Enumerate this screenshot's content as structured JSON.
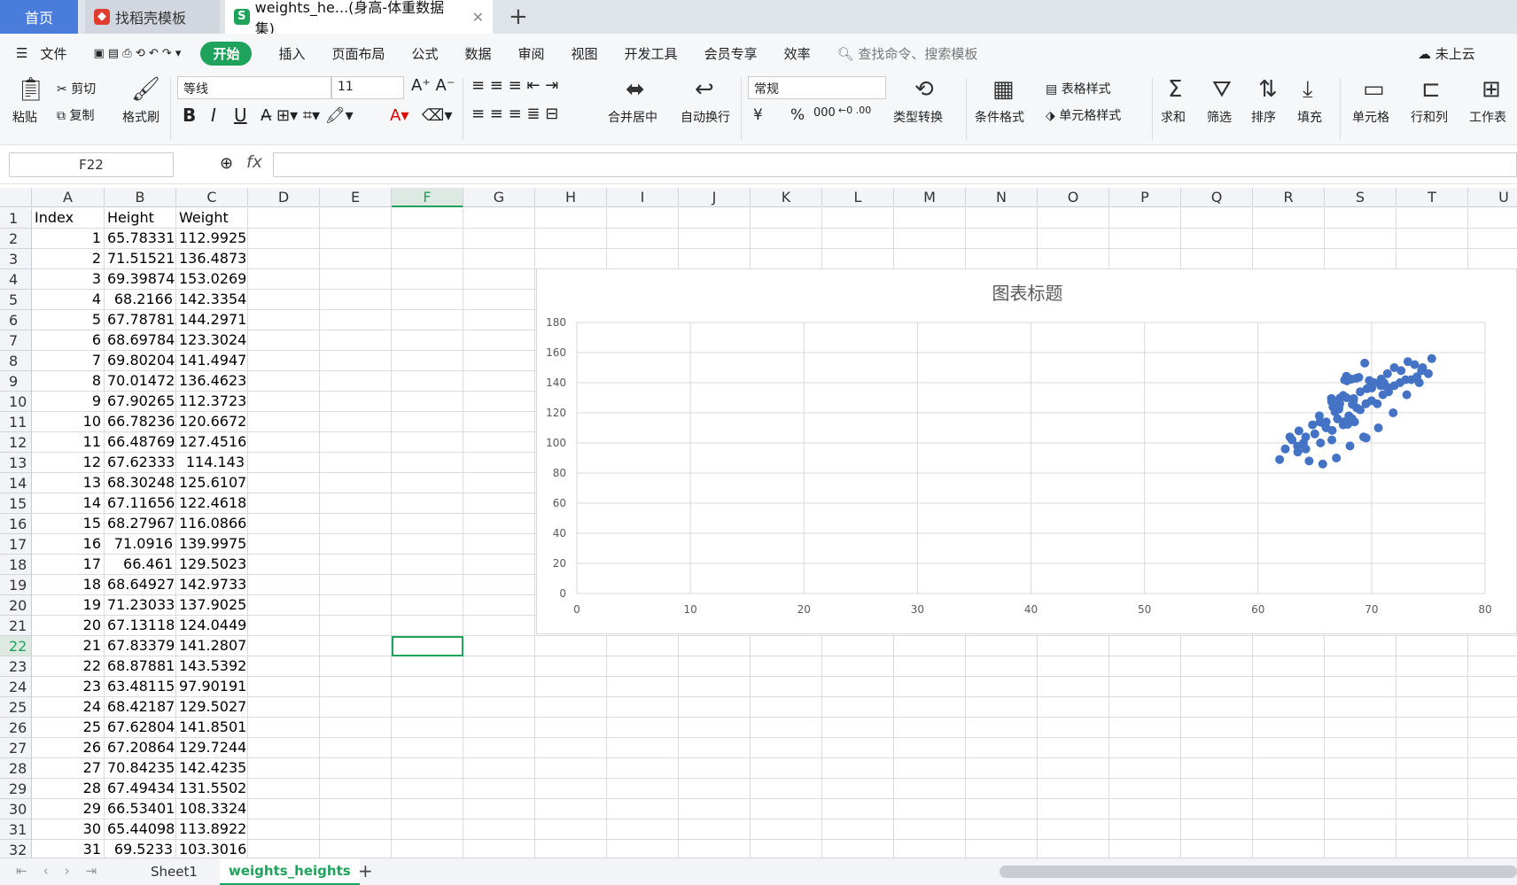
{
  "tabs": {
    "home": "首页",
    "daoke": "找稻壳模板",
    "file": "weights_he...(身高-体重数据集)",
    "file_icon": "S",
    "new_tab": "+"
  },
  "menu": {
    "file": "文件",
    "items": [
      "开始",
      "插入",
      "页面布局",
      "公式",
      "数据",
      "审阅",
      "视图",
      "开发工具",
      "会员专享",
      "效率"
    ],
    "search": "查找命令、搜索模板",
    "cloud": "未上云"
  },
  "toolbar": {
    "paste": "粘贴",
    "cut": "剪切",
    "copy": "复制",
    "format_painter": "格式刷",
    "font_name": "等线",
    "font_size": "11",
    "merge_center": "合并居中",
    "wrap_text": "自动换行",
    "number_format": "常规",
    "convert": "类型转换",
    "cond_format": "条件格式",
    "table_style": "表格样式",
    "cell_style": "单元格样式",
    "sum": "求和",
    "filter": "筛选",
    "sort": "排序",
    "fill": "填充",
    "cell": "单元格",
    "row_col": "行和列",
    "worksheet": "工作表",
    "bold": "B",
    "italic": "I",
    "underline": "U",
    "currency": "¥",
    "percent": "%",
    "thousands": "000"
  },
  "formula_bar": {
    "cell_ref": "F22",
    "fx": "fx",
    "value": ""
  },
  "columns": [
    "A",
    "B",
    "C",
    "D",
    "E",
    "F",
    "G",
    "H",
    "I",
    "J",
    "K",
    "L",
    "M",
    "N",
    "O",
    "P",
    "Q",
    "R",
    "S",
    "T",
    "U"
  ],
  "headers": [
    "Index",
    "Height",
    "Weight"
  ],
  "rows": [
    [
      "1",
      "65.78331",
      "112.9925"
    ],
    [
      "2",
      "71.51521",
      "136.4873"
    ],
    [
      "3",
      "69.39874",
      "153.0269"
    ],
    [
      "4",
      "68.2166",
      "142.3354"
    ],
    [
      "5",
      "67.78781",
      "144.2971"
    ],
    [
      "6",
      "68.69784",
      "123.3024"
    ],
    [
      "7",
      "69.80204",
      "141.4947"
    ],
    [
      "8",
      "70.01472",
      "136.4623"
    ],
    [
      "9",
      "67.90265",
      "112.3723"
    ],
    [
      "10",
      "66.78236",
      "120.6672"
    ],
    [
      "11",
      "66.48769",
      "127.4516"
    ],
    [
      "12",
      "67.62333",
      "114.143"
    ],
    [
      "13",
      "68.30248",
      "125.6107"
    ],
    [
      "14",
      "67.11656",
      "122.4618"
    ],
    [
      "15",
      "68.27967",
      "116.0866"
    ],
    [
      "16",
      "71.0916",
      "139.9975"
    ],
    [
      "17",
      "66.461",
      "129.5023"
    ],
    [
      "18",
      "68.64927",
      "142.9733"
    ],
    [
      "19",
      "71.23033",
      "137.9025"
    ],
    [
      "20",
      "67.13118",
      "124.0449"
    ],
    [
      "21",
      "67.83379",
      "141.2807"
    ],
    [
      "22",
      "68.87881",
      "143.5392"
    ],
    [
      "23",
      "63.48115",
      "97.90191"
    ],
    [
      "24",
      "68.42187",
      "129.5027"
    ],
    [
      "25",
      "67.62804",
      "141.8501"
    ],
    [
      "26",
      "67.20864",
      "129.7244"
    ],
    [
      "27",
      "70.84235",
      "142.4235"
    ],
    [
      "28",
      "67.49434",
      "131.5502"
    ],
    [
      "29",
      "66.53401",
      "108.3324"
    ],
    [
      "30",
      "65.44098",
      "113.8922"
    ],
    [
      "31",
      "69.5233",
      "103.3016"
    ]
  ],
  "sheets": {
    "sheet1": "Sheet1",
    "active": "weights_heights",
    "add": "+"
  },
  "chart_data": {
    "type": "scatter",
    "title": "图表标题",
    "xlabel": "",
    "ylabel": "",
    "xlim": [
      0,
      80
    ],
    "ylim": [
      0,
      180
    ],
    "x_ticks": [
      0,
      10,
      20,
      30,
      40,
      50,
      60,
      70,
      80
    ],
    "y_ticks": [
      0,
      20,
      40,
      60,
      80,
      100,
      120,
      140,
      160,
      180
    ],
    "color": "#4472c4",
    "grid": true,
    "series": [
      {
        "x": [
          65.78331,
          71.51521,
          69.39874,
          68.2166,
          67.78781,
          68.69784,
          69.80204,
          70.01472,
          67.90265,
          66.78236,
          66.48769,
          67.62333,
          68.30248,
          67.11656,
          68.27967,
          71.0916,
          66.461,
          68.64927,
          71.23033,
          67.13118,
          67.83379,
          68.87881,
          63.48115,
          68.42187,
          67.62804,
          67.20864,
          70.84235,
          67.49434,
          66.53401,
          65.44098,
          69.5233,
          61.9,
          62.4,
          63.0,
          63.6,
          64.2,
          64.8,
          65.4,
          66.0,
          66.6,
          67.2,
          67.8,
          68.4,
          69.0,
          69.6,
          70.2,
          70.8,
          71.4,
          72.0,
          72.6,
          73.2,
          73.8,
          74.4,
          75.0,
          64.0,
          65.0,
          66.0,
          67.0,
          68.0,
          69.0,
          70.0,
          71.0,
          72.0,
          73.0,
          74.0,
          63.5,
          65.5,
          67.5,
          69.5,
          71.5,
          73.5,
          64.5,
          66.5,
          68.5,
          70.5,
          72.5,
          74.5,
          62.8,
          64.2,
          65.7,
          66.9,
          68.1,
          69.3,
          70.6,
          71.9,
          73.1,
          74.2,
          75.3
        ],
        "y": [
          112.9925,
          136.4873,
          153.0269,
          142.3354,
          144.2971,
          123.3024,
          141.4947,
          136.4623,
          112.3723,
          120.6672,
          127.4516,
          114.143,
          125.6107,
          122.4618,
          116.0866,
          139.9975,
          129.5023,
          142.9733,
          137.9025,
          124.0449,
          141.2807,
          143.5392,
          97.90191,
          129.5027,
          141.8501,
          129.7244,
          142.4235,
          131.5502,
          108.3324,
          113.8922,
          103.3016,
          89,
          96,
          102,
          108,
          104,
          112,
          118,
          114,
          124,
          126,
          130,
          128,
          134,
          136,
          140,
          138,
          146,
          150,
          148,
          154,
          152,
          148,
          146,
          100,
          106,
          110,
          116,
          118,
          122,
          128,
          132,
          138,
          142,
          144,
          94,
          100,
          112,
          126,
          134,
          142,
          88,
          102,
          114,
          126,
          140,
          150,
          104,
          96,
          86,
          90,
          98,
          104,
          110,
          120,
          132,
          140,
          156
        ]
      }
    ]
  }
}
